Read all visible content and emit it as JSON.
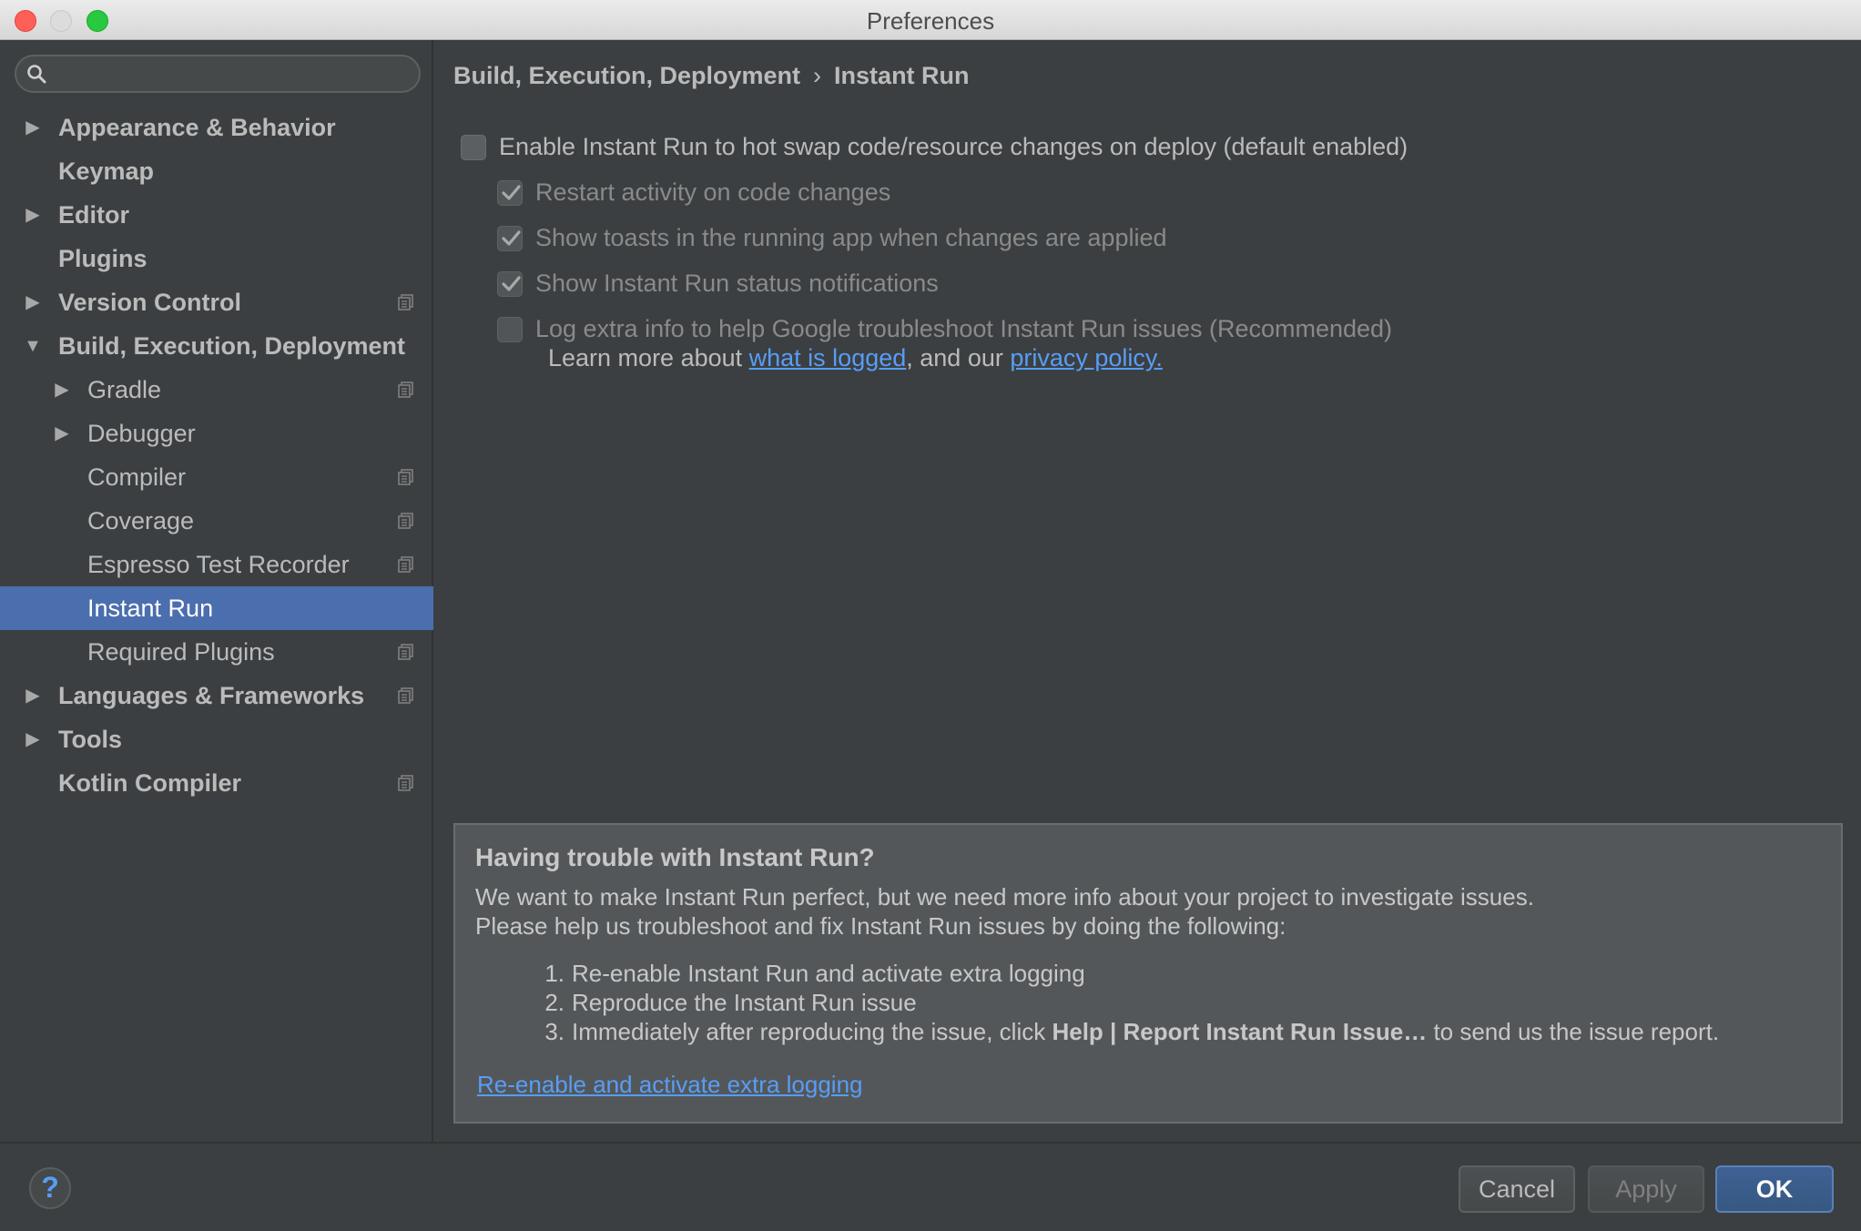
{
  "window": {
    "title": "Preferences"
  },
  "search": {
    "placeholder": ""
  },
  "sidebar": {
    "items": [
      {
        "label": "Appearance & Behavior",
        "expanded": false,
        "has_children": true,
        "bold": true,
        "level": 0,
        "project_icon": false
      },
      {
        "label": "Keymap",
        "has_children": false,
        "bold": true,
        "level": 0,
        "project_icon": false
      },
      {
        "label": "Editor",
        "expanded": false,
        "has_children": true,
        "bold": true,
        "level": 0,
        "project_icon": false
      },
      {
        "label": "Plugins",
        "has_children": false,
        "bold": true,
        "level": 0,
        "project_icon": false
      },
      {
        "label": "Version Control",
        "expanded": false,
        "has_children": true,
        "bold": true,
        "level": 0,
        "project_icon": true
      },
      {
        "label": "Build, Execution, Deployment",
        "expanded": true,
        "has_children": true,
        "bold": true,
        "level": 0,
        "project_icon": false
      },
      {
        "label": "Gradle",
        "expanded": false,
        "has_children": true,
        "bold": false,
        "level": 1,
        "project_icon": true
      },
      {
        "label": "Debugger",
        "expanded": false,
        "has_children": true,
        "bold": false,
        "level": 1,
        "project_icon": false
      },
      {
        "label": "Compiler",
        "has_children": false,
        "bold": false,
        "level": 1,
        "project_icon": true
      },
      {
        "label": "Coverage",
        "has_children": false,
        "bold": false,
        "level": 1,
        "project_icon": true
      },
      {
        "label": "Espresso Test Recorder",
        "has_children": false,
        "bold": false,
        "level": 1,
        "project_icon": true
      },
      {
        "label": "Instant Run",
        "has_children": false,
        "bold": false,
        "level": 1,
        "project_icon": false,
        "selected": true
      },
      {
        "label": "Required Plugins",
        "has_children": false,
        "bold": false,
        "level": 1,
        "project_icon": true
      },
      {
        "label": "Languages & Frameworks",
        "expanded": false,
        "has_children": true,
        "bold": true,
        "level": 0,
        "project_icon": true
      },
      {
        "label": "Tools",
        "expanded": false,
        "has_children": true,
        "bold": true,
        "level": 0,
        "project_icon": false
      },
      {
        "label": "Kotlin Compiler",
        "has_children": false,
        "bold": true,
        "level": 0,
        "project_icon": true
      }
    ]
  },
  "breadcrumb": {
    "parent": "Build, Execution, Deployment",
    "separator": "›",
    "current": "Instant Run"
  },
  "options": {
    "enable": {
      "label": "Enable Instant Run to hot swap code/resource changes on deploy (default enabled)",
      "checked": false,
      "enabled": true
    },
    "restart": {
      "label": "Restart activity on code changes",
      "checked": true,
      "enabled": false
    },
    "toasts": {
      "label": "Show toasts in the running app when changes are applied",
      "checked": true,
      "enabled": false
    },
    "notifications": {
      "label": "Show Instant Run status notifications",
      "checked": true,
      "enabled": false
    },
    "logging": {
      "label": "Log extra info to help Google troubleshoot Instant Run issues (Recommended)",
      "checked": false,
      "enabled": false
    }
  },
  "learn_more": {
    "prefix": "Learn more about ",
    "link1": "what is logged",
    "middle": ", and our ",
    "link2": "privacy policy."
  },
  "info_box": {
    "title": "Having trouble with Instant Run?",
    "line1": "We want to make Instant Run perfect, but we need more info about your project to investigate issues.",
    "line2": "Please help us troubleshoot and fix Instant Run issues by doing the following:",
    "steps": [
      {
        "num": "1.",
        "text": "Re-enable Instant Run and activate extra logging"
      },
      {
        "num": "2.",
        "text": "Reproduce the Instant Run issue"
      },
      {
        "num": "3.",
        "text_before": "Immediately after reproducing the issue, click ",
        "text_bold": "Help | Report Instant Run Issue…",
        "text_after": " to send us the issue report."
      }
    ],
    "link": "Re-enable and activate extra logging"
  },
  "buttons": {
    "help": "?",
    "cancel": "Cancel",
    "apply": "Apply",
    "ok": "OK"
  }
}
